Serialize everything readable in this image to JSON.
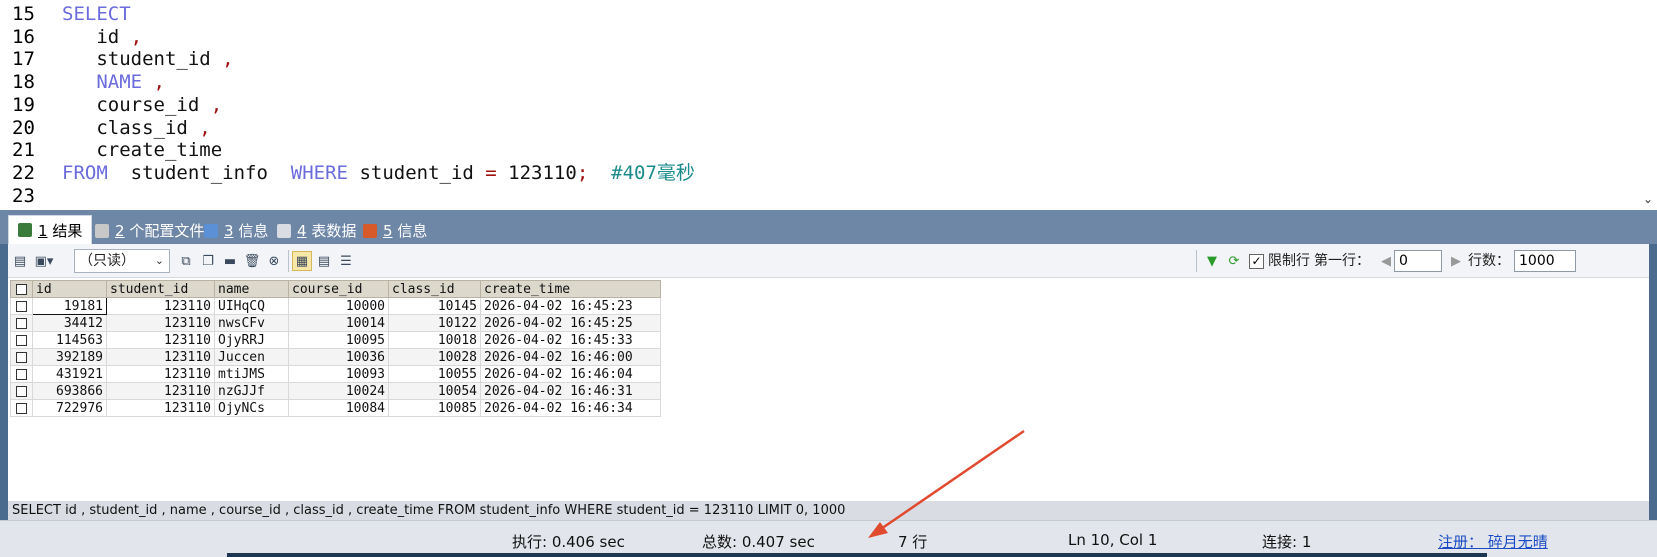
{
  "editor": {
    "lines": [
      {
        "num": "15",
        "tokens": [
          {
            "t": "SELECT",
            "c": "kw"
          }
        ]
      },
      {
        "num": "16",
        "tokens": [
          {
            "t": "   id ",
            "c": "id"
          },
          {
            "t": ",",
            "c": "op"
          }
        ]
      },
      {
        "num": "17",
        "tokens": [
          {
            "t": "   student_id ",
            "c": "id"
          },
          {
            "t": ",",
            "c": "op"
          }
        ]
      },
      {
        "num": "18",
        "tokens": [
          {
            "t": "   NAME ",
            "c": "kw"
          },
          {
            "t": ",",
            "c": "op"
          }
        ]
      },
      {
        "num": "19",
        "tokens": [
          {
            "t": "   course_id ",
            "c": "id"
          },
          {
            "t": ",",
            "c": "op"
          }
        ]
      },
      {
        "num": "20",
        "tokens": [
          {
            "t": "   class_id ",
            "c": "id"
          },
          {
            "t": ",",
            "c": "op"
          }
        ]
      },
      {
        "num": "21",
        "tokens": [
          {
            "t": "   create_time",
            "c": "id"
          }
        ]
      },
      {
        "num": "22",
        "tokens": [
          {
            "t": "FROM",
            "c": "kw"
          },
          {
            "t": "  student_info  ",
            "c": "id"
          },
          {
            "t": "WHERE",
            "c": "kw"
          },
          {
            "t": " student_id ",
            "c": "id"
          },
          {
            "t": "=",
            "c": "op"
          },
          {
            "t": " 123110",
            "c": "num"
          },
          {
            "t": ";",
            "c": "op"
          },
          {
            "t": "  #407毫秒",
            "c": "cm"
          }
        ]
      },
      {
        "num": "23",
        "tokens": []
      }
    ]
  },
  "tabs": [
    {
      "num": "1",
      "label": " 结果",
      "icon_color": "#3a7a3a"
    },
    {
      "num": "2",
      "label": " 个配置文件",
      "icon_color": "#c8c8c8"
    },
    {
      "num": "3",
      "label": " 信息",
      "icon_color": "#5b8fd6"
    },
    {
      "num": "4",
      "label": " 表数据",
      "icon_color": "#d9dde3"
    },
    {
      "num": "5",
      "label": " 信息",
      "icon_color": "#d85a2a"
    }
  ],
  "toolbar": {
    "mode": "（只读）",
    "limit_label": "限制行",
    "first_row_label": "第一行：",
    "first_row_value": "0",
    "rows_label": "行数：",
    "rows_value": "1000",
    "filter_icon_color": "#2a9a2a"
  },
  "grid": {
    "columns": [
      "id",
      "student_id",
      "name",
      "course_id",
      "class_id",
      "create_time"
    ],
    "rows": [
      [
        "19181",
        "123110",
        "UIHqCQ",
        "10000",
        "10145",
        "2026-04-02 16:45:23"
      ],
      [
        "34412",
        "123110",
        "nwsCFv",
        "10014",
        "10122",
        "2026-04-02 16:45:25"
      ],
      [
        "114563",
        "123110",
        "OjyRRJ",
        "10095",
        "10018",
        "2026-04-02 16:45:33"
      ],
      [
        "392189",
        "123110",
        "Juccen",
        "10036",
        "10028",
        "2026-04-02 16:46:00"
      ],
      [
        "431921",
        "123110",
        "mtiJMS",
        "10093",
        "10055",
        "2026-04-02 16:46:04"
      ],
      [
        "693866",
        "123110",
        "nzGJJf",
        "10024",
        "10054",
        "2026-04-02 16:46:31"
      ],
      [
        "722976",
        "123110",
        "OjyNCs",
        "10084",
        "10085",
        "2026-04-02 16:46:34"
      ]
    ]
  },
  "query_text": "SELECT id , student_id , name , course_id , class_id , create_time FROM student_info WHERE student_id = 123110 LIMIT 0, 1000",
  "status": {
    "exec": "执行: 0.406 sec",
    "total": "总数: 0.407 sec",
    "rows": "7 行",
    "position": "Ln 10, Col 1",
    "connection": "连接: 1",
    "register": "注册： 碎月无晴"
  },
  "colors": {
    "annotation_arrow": "#e04a2e",
    "keyword": "#6b6bdc",
    "comment": "#1b8a8a"
  }
}
